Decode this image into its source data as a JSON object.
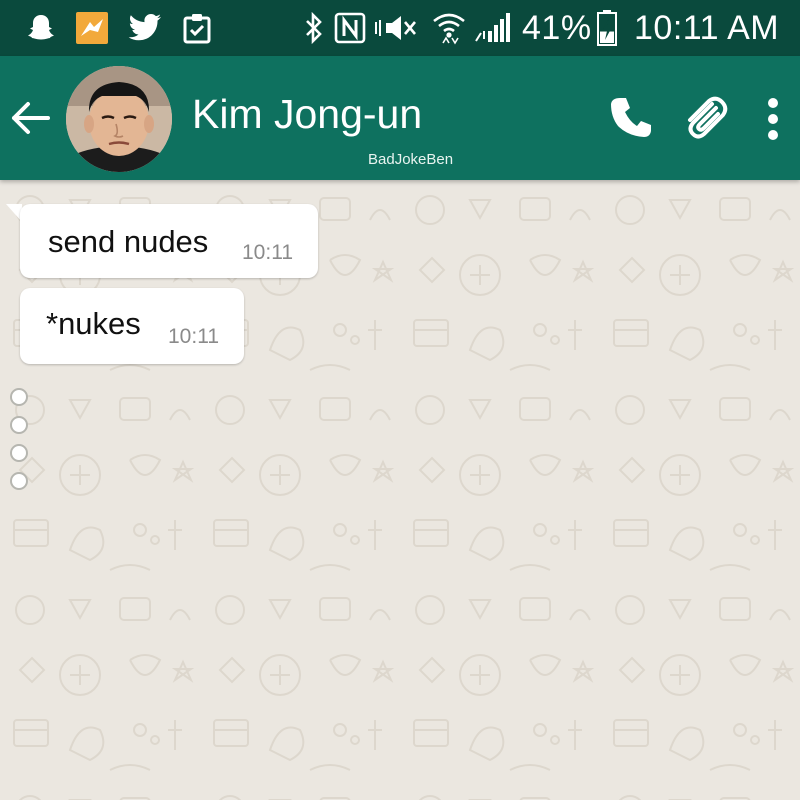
{
  "status_bar": {
    "notification_icons": [
      "snapchat-icon",
      "app-fox-icon",
      "twitter-icon",
      "clipboard-icon"
    ],
    "system_icons": [
      "bluetooth-icon",
      "nfc-icon",
      "mute-icon",
      "wifi-icon",
      "signal-icon"
    ],
    "battery_percent": "41%",
    "battery_level": 0.41,
    "time": "10:11 AM"
  },
  "header": {
    "contact_name": "Kim Jong-un",
    "watermark": "BadJokeBen",
    "actions": [
      "back-arrow-icon",
      "phone-icon",
      "paperclip-icon",
      "more-vert-icon"
    ]
  },
  "messages": [
    {
      "text": "send nudes",
      "time": "10:11"
    },
    {
      "text": "*nukes",
      "time": "10:11"
    }
  ],
  "typing_indicator": {
    "dot_count": 4
  },
  "colors": {
    "status_bar": "#0a4a3d",
    "app_bar": "#0e715f",
    "chat_background": "#ebe7e0",
    "bubble": "#ffffff",
    "timestamp": "#8a8a8a"
  }
}
